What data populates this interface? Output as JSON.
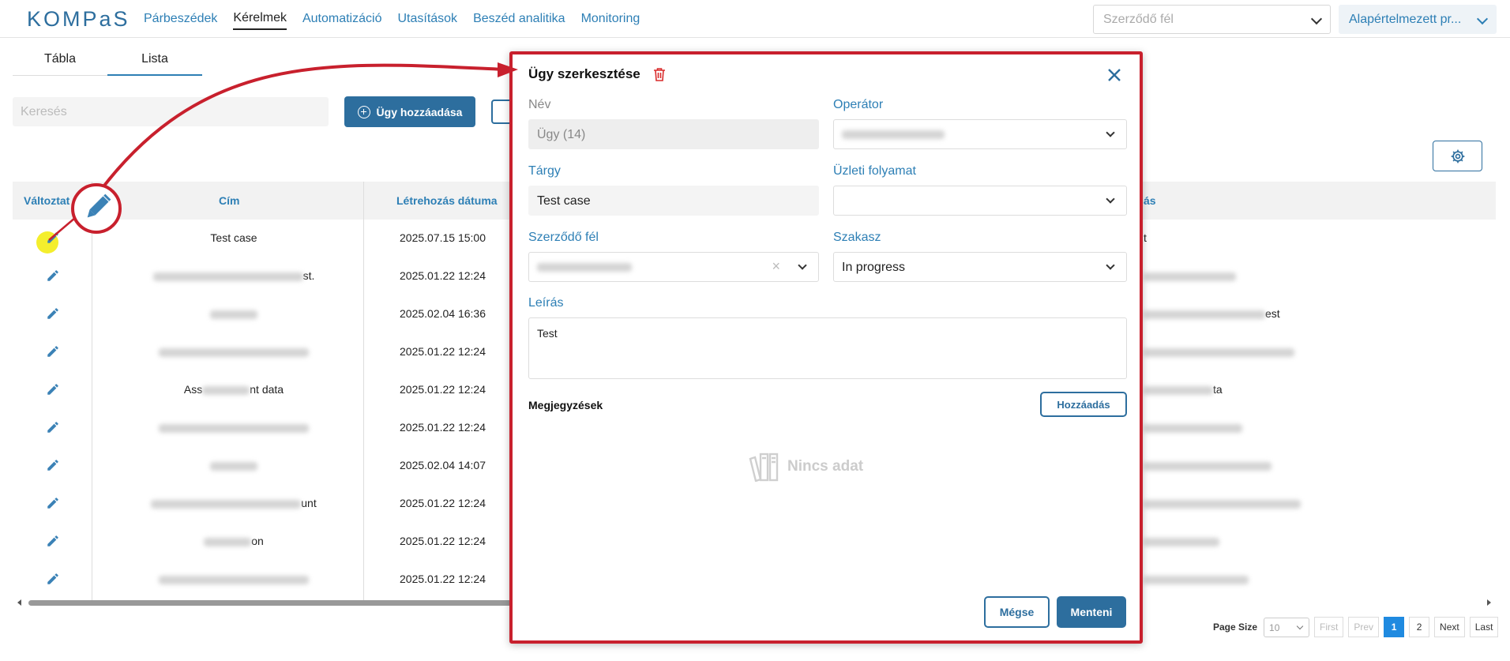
{
  "app": {
    "logo": "KOMPaS"
  },
  "nav": {
    "items": [
      {
        "label": "Párbeszédek",
        "active": false
      },
      {
        "label": "Kérelmek",
        "active": true
      },
      {
        "label": "Automatizáció",
        "active": false
      },
      {
        "label": "Utasítások",
        "active": false
      },
      {
        "label": "Beszéd analitika",
        "active": false
      },
      {
        "label": "Monitoring",
        "active": false
      }
    ],
    "party_placeholder": "Szerződő fél",
    "profile_value": "Alapértelmezett pr..."
  },
  "tabs": {
    "table": "Tábla",
    "list": "Lista",
    "active": "list"
  },
  "toolbar": {
    "search_placeholder": "Keresés",
    "add_label": "Ügy hozzáadása"
  },
  "grid": {
    "headers": {
      "edit": "Változtat",
      "title": "Cím",
      "created": "Létrehozás dátuma",
      "tail": "ás"
    },
    "rows": [
      {
        "title_pre": "",
        "title_post": "Test case",
        "date": "2025.07.15 15:00",
        "tail": "t"
      },
      {
        "title_pre": "",
        "title_post": "st.",
        "date": "2025.01.22 12:24",
        "tail": ""
      },
      {
        "title_pre": "",
        "title_post": "",
        "date": "2025.02.04 16:36",
        "tail": "est"
      },
      {
        "title_pre": "",
        "title_post": "",
        "date": "2025.01.22 12:24",
        "tail": ""
      },
      {
        "title_pre": "Ass",
        "title_post": "nt data",
        "date": "2025.01.22 12:24",
        "tail": "ta"
      },
      {
        "title_pre": "",
        "title_post": "",
        "date": "2025.01.22 12:24",
        "tail": ""
      },
      {
        "title_pre": "",
        "title_post": "",
        "date": "2025.02.04 14:07",
        "tail": ""
      },
      {
        "title_pre": "",
        "title_post": "unt",
        "date": "2025.01.22 12:24",
        "tail": ""
      },
      {
        "title_pre": "",
        "title_post": "on",
        "date": "2025.01.22 12:24",
        "tail": ""
      },
      {
        "title_pre": "",
        "title_post": "",
        "date": "2025.01.22 12:24",
        "tail": ""
      }
    ]
  },
  "pager": {
    "page_size_label": "Page Size",
    "page_size": "10",
    "first": "First",
    "prev": "Prev",
    "pages": [
      "1",
      "2"
    ],
    "current": "1",
    "next": "Next",
    "last": "Last"
  },
  "modal": {
    "title": "Ügy szerkesztése",
    "name_label": "Név",
    "name_value": "Ügy (14)",
    "operator_label": "Operátor",
    "subject_label": "Tárgy",
    "subject_value": "Test case",
    "process_label": "Üzleti folyamat",
    "process_value": "",
    "party_label": "Szerződő fél",
    "stage_label": "Szakasz",
    "stage_value": "In progress",
    "desc_label": "Leírás",
    "desc_value": "Test",
    "notes_label": "Megjegyzések",
    "notes_add": "Hozzáadás",
    "empty_text": "Nincs adat",
    "cancel": "Mégse",
    "save": "Menteni"
  },
  "colors": {
    "accent": "#2d6e9e",
    "link": "#2d7fb5",
    "annotation": "#c8202d",
    "highlight": "#f4ee2d"
  }
}
